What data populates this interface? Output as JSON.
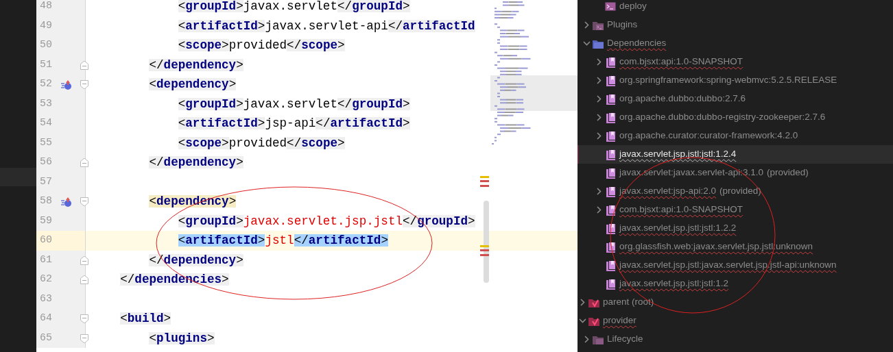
{
  "editor": {
    "lines": [
      {
        "number": "48",
        "segments": [
          {
            "kind": "tag",
            "text": "            <groupId>"
          },
          {
            "kind": "text",
            "text": "javax.servlet"
          },
          {
            "kind": "tag",
            "text": "</groupId>"
          }
        ]
      },
      {
        "number": "49",
        "segments": [
          {
            "kind": "tag",
            "text": "            <artifactId>"
          },
          {
            "kind": "text",
            "text": "javax.servlet-api"
          },
          {
            "kind": "tag",
            "text": "</artifactId"
          }
        ]
      },
      {
        "number": "50",
        "segments": [
          {
            "kind": "tag",
            "text": "            <scope>"
          },
          {
            "kind": "text",
            "text": "provided"
          },
          {
            "kind": "tag",
            "text": "</scope>"
          }
        ]
      },
      {
        "number": "51",
        "fold_end": true,
        "segments": [
          {
            "kind": "tag",
            "text": "        </dependency>"
          }
        ]
      },
      {
        "number": "52",
        "fold_start": true,
        "marker": true,
        "segments": [
          {
            "kind": "tag",
            "text": "        <dependency>"
          }
        ]
      },
      {
        "number": "53",
        "segments": [
          {
            "kind": "tag",
            "text": "            <groupId>"
          },
          {
            "kind": "text",
            "text": "javax.servlet"
          },
          {
            "kind": "tag",
            "text": "</groupId>"
          }
        ]
      },
      {
        "number": "54",
        "segments": [
          {
            "kind": "tag",
            "text": "            <artifactId>"
          },
          {
            "kind": "text",
            "text": "jsp-api"
          },
          {
            "kind": "tag",
            "text": "</artifactId>"
          }
        ]
      },
      {
        "number": "55",
        "segments": [
          {
            "kind": "tag",
            "text": "            <scope>"
          },
          {
            "kind": "text",
            "text": "provided"
          },
          {
            "kind": "tag",
            "text": "</scope>"
          }
        ]
      },
      {
        "number": "56",
        "fold_end": true,
        "segments": [
          {
            "kind": "tag",
            "text": "        </dependency>"
          }
        ]
      },
      {
        "number": "57"
      },
      {
        "number": "58",
        "fold_start": true,
        "marker": true,
        "segments": [
          {
            "kind": "tag",
            "text": "        <dependency>",
            "matched": true
          }
        ]
      },
      {
        "number": "59",
        "segments": [
          {
            "kind": "tag",
            "text": "            <groupId>"
          },
          {
            "kind": "error",
            "text": "javax.servlet.jsp.jstl"
          },
          {
            "kind": "tag",
            "text": "</groupId>"
          }
        ]
      },
      {
        "number": "60",
        "current": true,
        "segments": [
          {
            "kind": "tag",
            "text": "            <artifactId>",
            "selected": true
          },
          {
            "kind": "error",
            "text": "jstl"
          },
          {
            "kind": "tag",
            "text": "</artifactId>",
            "selected": true
          }
        ]
      },
      {
        "number": "61",
        "fold_end": true,
        "segments": [
          {
            "kind": "tag",
            "text": "        </dependency>"
          }
        ]
      },
      {
        "number": "62",
        "fold_end": true,
        "segments": [
          {
            "kind": "tag",
            "text": "    </dependencies>"
          }
        ]
      },
      {
        "number": "63"
      },
      {
        "number": "64",
        "fold_start": true,
        "segments": [
          {
            "kind": "tag",
            "text": "    <build>"
          }
        ]
      },
      {
        "number": "65",
        "fold_start": true,
        "segments": [
          {
            "kind": "tag",
            "text": "        <plugins>"
          }
        ]
      }
    ]
  },
  "tree": [
    {
      "children": [
        {
          "children": [
            {
              "label": "deploy",
              "kind": "goal",
              "selected": false
            }
          ]
        },
        {
          "label": "Plugins",
          "kind": "plugins",
          "expanded": false,
          "selected": false
        },
        {
          "label": "Dependencies",
          "kind": "dependencies",
          "expanded": true,
          "error": true,
          "selected": false,
          "children": [
            {
              "label": "com.bjsxt:api:1.0-SNAPSHOT",
              "kind": "library",
              "expanded": false,
              "error": true,
              "selected": false
            },
            {
              "label": "org.springframework:spring-webmvc:5.2.5.RELEASE",
              "kind": "library",
              "expanded": false,
              "error": false,
              "selected": false
            },
            {
              "label": "org.apache.dubbo:dubbo:2.7.6",
              "kind": "library",
              "expanded": false,
              "error": false,
              "selected": false
            },
            {
              "label": "org.apache.dubbo:dubbo-registry-zookeeper:2.7.6",
              "kind": "library",
              "expanded": false,
              "error": false,
              "selected": false
            },
            {
              "label": "org.apache.curator:curator-framework:4.2.0",
              "kind": "library",
              "expanded": false,
              "error": false,
              "selected": false
            },
            {
              "label": "javax.servlet.jsp.jstl:jstl:1.2.4",
              "kind": "library",
              "error": true,
              "selected": true
            },
            {
              "label": "javax.servlet:javax.servlet-api:3.1.0",
              "scope": "(provided)",
              "kind": "library",
              "error": false,
              "selected": false
            },
            {
              "label": "javax.servlet:jsp-api:2.0",
              "scope": "(provided)",
              "kind": "library",
              "expanded": false,
              "error": true,
              "selected": false
            },
            {
              "label": "com.bjsxt:api:1.0-SNAPSHOT",
              "kind": "library",
              "expanded": false,
              "error": true,
              "selected": false
            },
            {
              "label": "javax.servlet.jsp.jstl:jstl:1.2.2",
              "kind": "library",
              "error": true,
              "selected": false
            },
            {
              "label": "org.glassfish.web:javax.servlet.jsp.jstl:unknown",
              "kind": "library",
              "error": true,
              "selected": false
            },
            {
              "label": "javax.servlet.jsp.jstl:javax.servlet.jsp.jstl-api:unknown",
              "kind": "library",
              "error": true,
              "selected": false
            },
            {
              "label": "javax.servlet.jsp.jstl:jstl:1.2",
              "kind": "library",
              "error": true,
              "selected": false
            }
          ]
        }
      ]
    },
    {
      "label": "parent (root)",
      "kind": "module",
      "expanded": false,
      "error": false,
      "selected": false
    },
    {
      "label": "provider",
      "kind": "module",
      "expanded": true,
      "error": true,
      "selected": false,
      "children": [
        {
          "label": "Lifecycle",
          "kind": "lifecycle",
          "expanded": false,
          "selected": false
        }
      ]
    }
  ]
}
